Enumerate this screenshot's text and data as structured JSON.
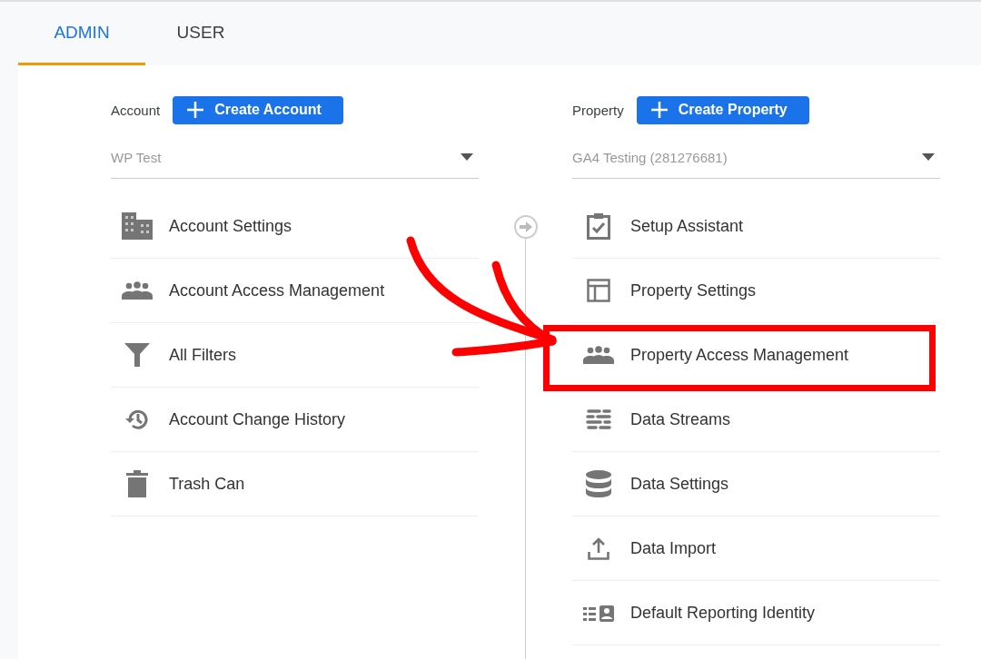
{
  "tabs": [
    {
      "label": "ADMIN",
      "selected": true
    },
    {
      "label": "USER",
      "selected": false
    }
  ],
  "account": {
    "label": "Account",
    "button": "Create Account",
    "value": "WP Test",
    "items": [
      {
        "label": "Account Settings",
        "highlighted": false
      },
      {
        "label": "Account Access Management",
        "highlighted": false
      },
      {
        "label": "All Filters",
        "highlighted": false
      },
      {
        "label": "Account Change History",
        "highlighted": false
      },
      {
        "label": "Trash Can",
        "highlighted": false
      }
    ]
  },
  "property": {
    "label": "Property",
    "button": "Create Property",
    "value": "GA4 Testing (281276681)",
    "items": [
      {
        "label": "Setup Assistant",
        "highlighted": false
      },
      {
        "label": "Property Settings",
        "highlighted": false
      },
      {
        "label": "Property Access Management",
        "highlighted": true
      },
      {
        "label": "Data Streams",
        "highlighted": false
      },
      {
        "label": "Data Settings",
        "highlighted": false
      },
      {
        "label": "Data Import",
        "highlighted": false
      },
      {
        "label": "Default Reporting Identity",
        "highlighted": false
      }
    ]
  }
}
